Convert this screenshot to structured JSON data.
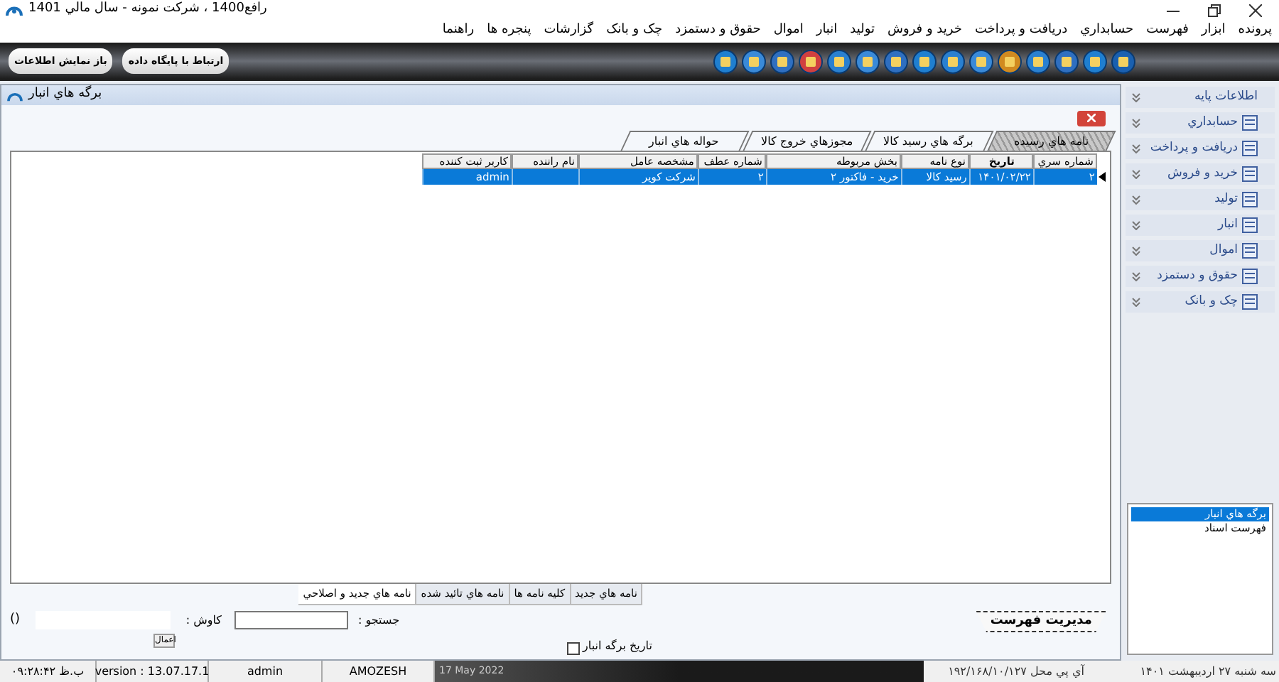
{
  "window": {
    "title": "رافع1400 ، شرکت نمونه - سال مالي 1401"
  },
  "menu": [
    "پرونده",
    "ابزار",
    "فهرست",
    "حسابداري",
    "دريافت و پرداخت",
    "خريد و فروش",
    "توليد",
    "انبار",
    "اموال",
    "حقوق و دستمزد",
    "چک و بانک",
    "گزارشات",
    "پنجره ها",
    "راهنما"
  ],
  "toolbar": {
    "buttons": [
      "ارتباط با پايگاه داده",
      "باز نمايش اطلاعات"
    ],
    "icons": [
      {
        "color": "#1f7fd0"
      },
      {
        "color": "#3a8ad8"
      },
      {
        "color": "#2f6fc0"
      },
      {
        "color": "#d04040"
      },
      {
        "color": "#2a80d0"
      },
      {
        "color": "#3a8ad8"
      },
      {
        "color": "#2f6fc0"
      },
      {
        "color": "#1f7fd0"
      },
      {
        "color": "#2a80d0"
      },
      {
        "color": "#3a8ad8"
      },
      {
        "color": "#d08a20"
      },
      {
        "color": "#2a80d0"
      },
      {
        "color": "#2f6fc0"
      },
      {
        "color": "#1f7fd0"
      },
      {
        "color": "#1a60b0"
      }
    ]
  },
  "child_window": {
    "title": "برگه هاي انبار",
    "tabs": [
      {
        "label": "نامه هاي رسيده",
        "selected": true
      },
      {
        "label": "برگه هاي رسيد کالا",
        "selected": false
      },
      {
        "label": "مجوزهاي خروج کالا",
        "selected": false
      },
      {
        "label": "حواله هاي انبار",
        "selected": false
      }
    ],
    "table": {
      "columns": [
        "شماره سري",
        "تاريخ",
        "نوع نامه",
        "بخش مربوطه",
        "شماره عطف",
        "مشخصه عامل",
        "نام راننده",
        "کاربر ثبت کننده"
      ],
      "rows": [
        {
          "selected": true,
          "cells": [
            "۲",
            "۱۴۰۱/۰۲/۲۲",
            "رسيد کالا",
            "خريد - فاکتور ۲",
            "۲",
            "شرکت کوير",
            null,
            "admin"
          ]
        }
      ]
    },
    "bottom_tabs": [
      {
        "label": "نامه هاي جديد",
        "selected": false
      },
      {
        "label": "کليه نامه ها",
        "selected": false
      },
      {
        "label": "نامه هاي تائيد شده",
        "selected": false
      },
      {
        "label": "نامه هاي جديد و اصلاحي",
        "selected": true
      }
    ],
    "search_label": "جستجو :",
    "explore_label": "کاوش :",
    "count": "()",
    "apply_button": "اعمال",
    "date_filter": {
      "label": "تاريخ برگه انبار",
      "checked": false
    },
    "manage_button": "مديريت فهرست"
  },
  "sidebar": {
    "items": [
      "اطلاعات پايه",
      "حسابداري",
      "دريافت و پرداخت",
      "خريد و فروش",
      "توليد",
      "انبار",
      "اموال",
      "حقوق و دستمزد",
      "چک و بانک"
    ],
    "list": [
      {
        "label": "برگه هاي انبار",
        "selected": true
      },
      {
        "label": "فهرست اسناد",
        "selected": false
      }
    ]
  },
  "status_bar": {
    "time": "ب.ظ ۰۹:۲۸:۴۲",
    "version": "version : 13.07.17.1",
    "user": "admin",
    "database": "AMOZESH",
    "date": "17 May 2022",
    "ip": "آي پي محل ۱۹۲/۱۶۸/۱۰/۱۲۷",
    "persian_date": "سه شنبه ۲۷ ارديبهشت ۱۴۰۱"
  }
}
